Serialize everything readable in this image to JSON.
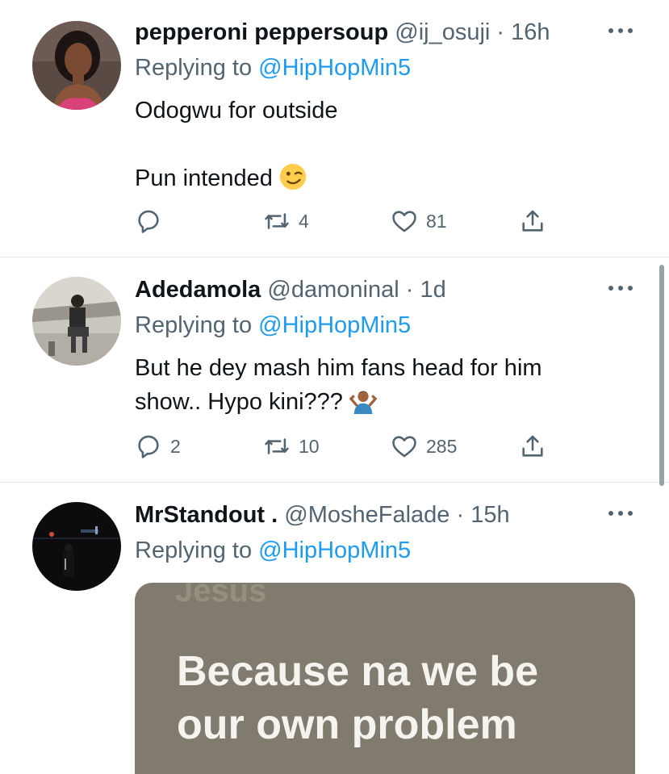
{
  "tweets": [
    {
      "name": "pepperoni peppersoup",
      "handle": "@ij_osuji",
      "dot": "·",
      "time": "16h",
      "replying_prefix": "Replying to ",
      "replying_to": "@HipHopMin5",
      "body_lines": [
        "Odogwu for outside",
        "",
        "Pun intended"
      ],
      "body_emoji": "winking-face",
      "replies": "",
      "retweets": "4",
      "likes": "81"
    },
    {
      "name": "Adedamola",
      "handle": "@damoninal",
      "dot": "·",
      "time": "1d",
      "replying_prefix": "Replying to ",
      "replying_to": "@HipHopMin5",
      "body_lines": [
        "But he dey mash him fans head for him",
        "show.. Hypo kini???"
      ],
      "body_emoji": "person-shrugging",
      "replies": "2",
      "retweets": "10",
      "likes": "285"
    },
    {
      "name": "MrStandout .",
      "handle": "@MosheFalade",
      "dot": "·",
      "time": "15h",
      "replying_prefix": "Replying to ",
      "replying_to": "@HipHopMin5",
      "media_text_lines": [
        "Because na we be",
        "our own problem"
      ],
      "media_partial_text": "Jesus"
    }
  ],
  "colors": {
    "link": "#1d9bf0",
    "secondary_text": "#536471",
    "primary_text": "#0f1419",
    "divider": "#e6e9ec",
    "media_bg": "#807b6e"
  }
}
